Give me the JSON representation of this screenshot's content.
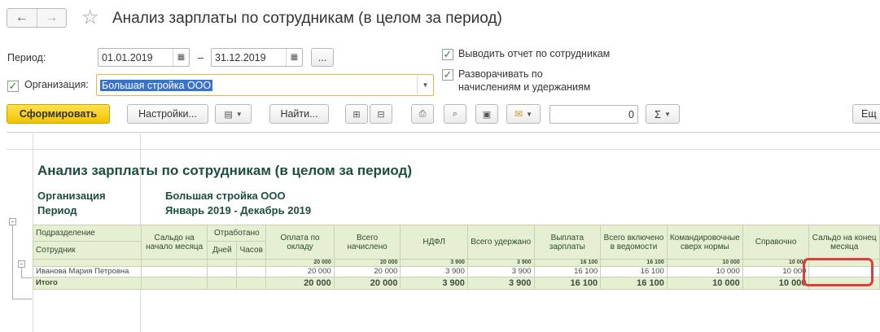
{
  "window": {
    "title": "Анализ зарплаты по сотрудникам (в целом за период)"
  },
  "nav": {
    "back": "←",
    "forward": "→",
    "favorite": "☆"
  },
  "form": {
    "period_label": "Период:",
    "period_from": "01.01.2019",
    "period_dash": "–",
    "period_to": "31.12.2019",
    "period_more": "...",
    "org_label": "Организация:",
    "org_value": "Большая стройка ООО",
    "opt_by_employee": "Выводить отчет по сотрудникам",
    "opt_expand_1": "Разворачивать по",
    "opt_expand_2": "начислениям и удержаниям"
  },
  "toolbar": {
    "generate": "Сформировать",
    "settings": "Настройки...",
    "find": "Найти...",
    "sum_value": "0",
    "sigma": "Σ",
    "more": "Ещ"
  },
  "report": {
    "title": "Анализ зарплаты по сотрудникам (в целом за период)",
    "org_label": "Организация",
    "org_value": "Большая стройка ООО",
    "period_label": "Период",
    "period_value": "Январь 2019 - Декабрь 2019",
    "headers": {
      "division": "Подразделение",
      "employee": "Сотрудник",
      "opening_balance": "Сальдо на начало месяца",
      "worked": "Отработано",
      "days": "Дней",
      "hours": "Часов",
      "salary": "Оплата по окладу",
      "accrued": "Всего начислено",
      "ndfl": "НДФЛ",
      "withheld": "Всего удержано",
      "payout": "Выплата зарплаты",
      "in_statements": "Всего включено в ведомости",
      "trips": "Командировочные сверх нормы",
      "reference": "Справочно",
      "closing_balance": "Сальдо на конец месяца"
    },
    "group_row": [
      "20 000",
      "20 000",
      "3 900",
      "3 900",
      "16 100",
      "16 100",
      "10 000",
      "10 000"
    ],
    "employee_row": {
      "name": "Иванова Мария Петровна",
      "values": [
        "20 000",
        "20 000",
        "3 900",
        "3 900",
        "16 100",
        "16 100",
        "10 000",
        "10 000"
      ]
    },
    "total_row": {
      "name": "Итого",
      "values": [
        "20 000",
        "20 000",
        "3 900",
        "3 900",
        "16 100",
        "16 100",
        "10 000",
        "10 000"
      ]
    }
  }
}
